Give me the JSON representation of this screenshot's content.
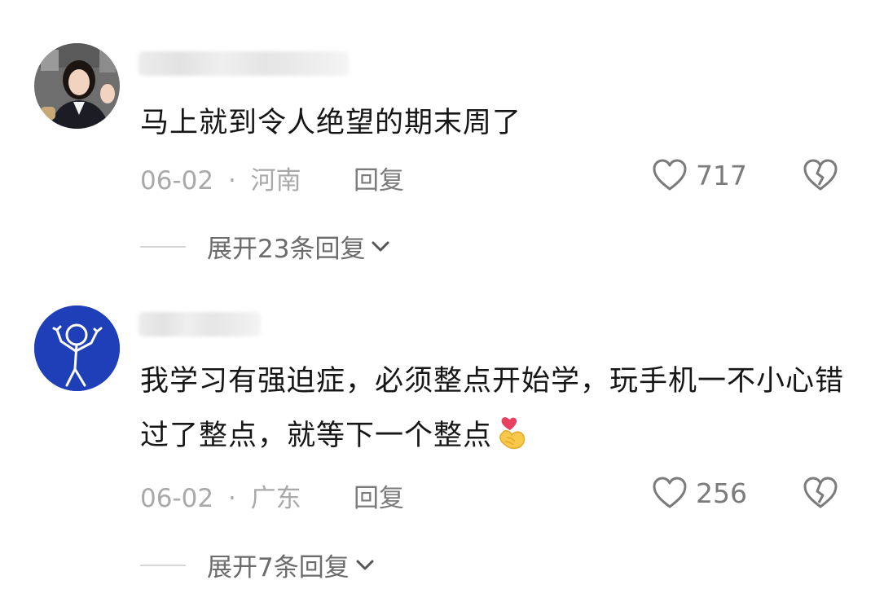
{
  "comments": [
    {
      "text": "马上就到令人绝望的期末周了",
      "date": "06-02",
      "separator": "·",
      "location": "河南",
      "reply_label": "回复",
      "like_count": "717",
      "expand_label": "展开23条回复"
    },
    {
      "text": "我学习有强迫症，必须整点开始学，玩手机一不小心错过了整点，就等下一个整点",
      "date": "06-02",
      "separator": "·",
      "location": "广东",
      "reply_label": "回复",
      "like_count": "256",
      "expand_label": "展开7条回复"
    }
  ],
  "icons": {
    "like": "heart-outline-icon",
    "dislike": "broken-heart-icon",
    "expand": "chevron-down-icon",
    "emoji": "finger-heart-emoji"
  },
  "colors": {
    "text": "#161616",
    "meta": "#a9a9a9",
    "action": "#7b7b7b",
    "avatar2_bg": "#1f3fb8"
  }
}
